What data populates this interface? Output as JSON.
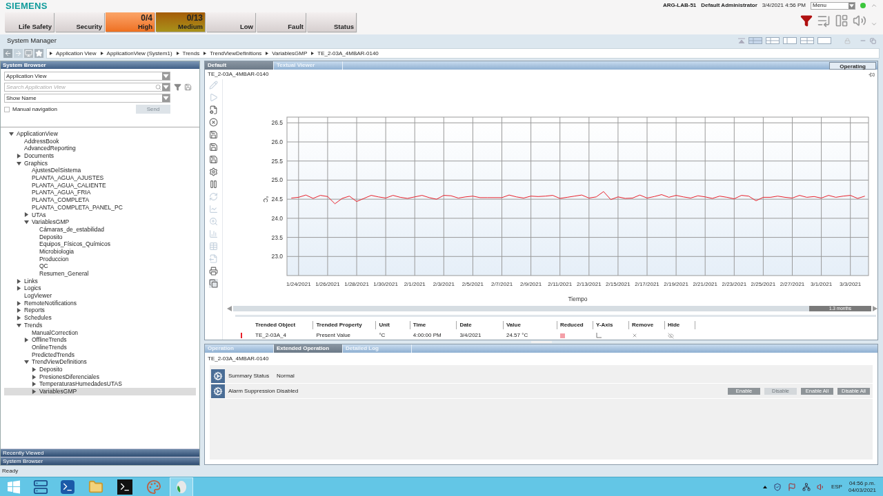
{
  "header": {
    "logo": "SIEMENS",
    "host": "ARG-LAB-51",
    "user": "Default Administrator",
    "date": "3/4/2021",
    "time": "4:56 PM",
    "menu": "Menu",
    "online": true
  },
  "alarm_buttons": [
    {
      "label": "Life Safety",
      "kind": "normal"
    },
    {
      "label": "Security",
      "kind": "normal"
    },
    {
      "label": "High",
      "count": "0/4",
      "kind": "high"
    },
    {
      "label": "Medium",
      "count": "0/13",
      "kind": "medium"
    },
    {
      "label": "Low",
      "kind": "normal"
    },
    {
      "label": "Fault",
      "kind": "normal"
    },
    {
      "label": "Status",
      "kind": "normal"
    }
  ],
  "window": {
    "title": "System Manager"
  },
  "breadcrumb": [
    "Application View",
    "ApplicationView (System1)",
    "Trends",
    "TrendViewDefinitions",
    "VariablesGMP",
    "TE_2-03A_4MBAR-0140"
  ],
  "system_browser": {
    "title": "System Browser",
    "view": "Application View",
    "search": {
      "placeholder": "Search Application View"
    },
    "display": "Show Name",
    "manual_navigation": {
      "label": "Manual navigation",
      "checked": false
    },
    "send": {
      "label": "Send",
      "disabled": true
    },
    "tree": [
      {
        "label": "ApplicationView",
        "expanded": true,
        "selected": false,
        "children": [
          {
            "label": "AddressBook",
            "selected": false
          },
          {
            "label": "AdvancedReporting",
            "selected": false
          },
          {
            "label": "Documents",
            "expanded": false,
            "selected": false
          },
          {
            "label": "Graphics",
            "expanded": true,
            "selected": false,
            "children": [
              {
                "label": "AjustesDelSistema",
                "selected": false
              },
              {
                "label": "PLANTA_AGUA_AJUSTES",
                "selected": false
              },
              {
                "label": "PLANTA_AGUA_CALIENTE",
                "selected": false
              },
              {
                "label": "PLANTA_AGUA_FRIA",
                "selected": false
              },
              {
                "label": "PLANTA_COMPLETA",
                "selected": false
              },
              {
                "label": "PLANTA_COMPLETA_PANEL_PC",
                "selected": false
              },
              {
                "label": "UTAs",
                "expanded": false,
                "selected": false
              },
              {
                "label": "VariablesGMP",
                "expanded": true,
                "selected": false,
                "children": [
                  {
                    "label": "Cámaras_de_estabilidad",
                    "selected": false
                  },
                  {
                    "label": "Deposito",
                    "selected": false
                  },
                  {
                    "label": "Equipos_Físicos_Químicos",
                    "selected": false
                  },
                  {
                    "label": "Microbiologia",
                    "selected": false
                  },
                  {
                    "label": "Produccion",
                    "selected": false
                  },
                  {
                    "label": "QC",
                    "selected": false
                  },
                  {
                    "label": "Resumen_General",
                    "selected": false
                  }
                ]
              }
            ]
          },
          {
            "label": "Links",
            "expanded": false,
            "selected": false
          },
          {
            "label": "Logics",
            "expanded": false,
            "selected": false
          },
          {
            "label": "LogViewer",
            "selected": false
          },
          {
            "label": "RemoteNotifications",
            "expanded": false,
            "selected": false
          },
          {
            "label": "Reports",
            "expanded": false,
            "selected": false
          },
          {
            "label": "Schedules",
            "expanded": false,
            "selected": false
          },
          {
            "label": "Trends",
            "expanded": true,
            "selected": false,
            "children": [
              {
                "label": "ManualCorrection",
                "selected": false
              },
              {
                "label": "OfflineTrends",
                "expanded": false,
                "selected": false
              },
              {
                "label": "OnlineTrends",
                "selected": false
              },
              {
                "label": "PredictedTrends",
                "selected": false
              },
              {
                "label": "TrendViewDefinitions",
                "expanded": true,
                "selected": false,
                "children": [
                  {
                    "label": "Deposito",
                    "expanded": false,
                    "selected": false
                  },
                  {
                    "label": "PresionesDiferenciales",
                    "expanded": false,
                    "selected": false
                  },
                  {
                    "label": "TemperaturasHumedadesUTAS",
                    "expanded": false,
                    "selected": false
                  },
                  {
                    "label": "VariablesGMP",
                    "expanded": false,
                    "selected": true
                  }
                ]
              }
            ]
          }
        ]
      }
    ],
    "bottom_bars": [
      "Recently Viewed",
      "System Browser"
    ]
  },
  "trend_pane": {
    "tabs": [
      {
        "label": "Default",
        "selected": true
      },
      {
        "label": "Textual Viewer",
        "selected": false
      }
    ],
    "mode": "Operating",
    "object": "TE_2-03A_4MBAR-0140",
    "toolbar": [
      {
        "disabled": true
      },
      {
        "disabled": true
      },
      {
        "disabled": false
      },
      {
        "disabled": false
      },
      {
        "disabled": false
      },
      {
        "disabled": false
      },
      {
        "disabled": false
      },
      {
        "disabled": false
      },
      {
        "disabled": false
      },
      {
        "disabled": true
      },
      {
        "disabled": true
      },
      {
        "disabled": true
      },
      {
        "disabled": true
      },
      {
        "disabled": true
      },
      {
        "disabled": true
      },
      {
        "disabled": false
      },
      {
        "disabled": false
      }
    ],
    "chart_data": {
      "type": "line",
      "xlabel": "Tiempo",
      "ylabel": "°C",
      "grid": true,
      "ylim": [
        22.5,
        26.65
      ],
      "yticks": [
        {
          "value": 23,
          "label": "23.0"
        },
        23.5,
        {
          "value": 24,
          "label": "24.0"
        },
        24.5,
        {
          "value": 25,
          "label": "25.0"
        },
        25.5,
        {
          "value": 26,
          "label": "26.0"
        },
        26.5
      ],
      "categories": [
        null,
        "1/24/2021",
        null,
        null,
        null,
        "1/26/2021",
        null,
        null,
        null,
        "1/28/2021",
        null,
        null,
        null,
        "1/30/2021",
        null,
        null,
        null,
        "2/1/2021",
        null,
        null,
        null,
        "2/3/2021",
        null,
        null,
        null,
        "2/5/2021",
        null,
        null,
        null,
        "2/7/2021",
        null,
        null,
        null,
        "2/9/2021",
        null,
        null,
        null,
        "2/11/2021",
        null,
        null,
        null,
        "2/13/2021",
        null,
        null,
        null,
        "2/15/2021",
        null,
        null,
        null,
        "2/17/2021",
        null,
        null,
        null,
        "2/19/2021",
        null,
        null,
        null,
        "2/21/2021",
        null,
        null,
        null,
        "2/23/2021",
        null,
        null,
        null,
        "2/25/2021",
        null,
        null,
        null,
        "2/27/2021",
        null,
        null,
        null,
        "3/1/2021",
        null,
        null,
        null,
        "3/3/2021",
        null,
        null
      ],
      "series": [
        {
          "name": "TE_2-03A_4",
          "color": "#e8202a",
          "values": [
            24.53,
            24.55,
            24.61,
            24.52,
            24.6,
            24.57,
            24.38,
            24.52,
            24.58,
            24.44,
            24.52,
            24.6,
            24.56,
            24.53,
            24.6,
            24.55,
            24.52,
            24.56,
            24.6,
            24.54,
            24.5,
            24.6,
            24.59,
            24.53,
            24.56,
            24.58,
            24.54,
            24.54,
            24.54,
            24.54,
            24.61,
            24.56,
            24.53,
            24.58,
            24.57,
            24.58,
            24.6,
            24.52,
            24.55,
            24.58,
            24.61,
            24.53,
            24.56,
            24.7,
            24.49,
            24.56,
            24.52,
            24.53,
            24.61,
            24.53,
            24.57,
            24.62,
            24.55,
            24.6,
            24.56,
            24.53,
            24.59,
            24.56,
            24.52,
            24.58,
            24.55,
            24.51,
            24.6,
            24.58,
            24.46,
            24.55,
            24.55,
            24.58,
            24.55,
            24.53,
            24.6,
            24.55,
            24.57,
            24.53,
            24.6,
            24.55,
            24.58,
            24.6,
            24.52,
            24.58
          ]
        }
      ]
    },
    "range": "1.3 months",
    "legend": {
      "columns": [
        "Trended Object",
        "Trended Property",
        "Unit",
        "Time",
        "Date",
        "Value",
        "Reduced",
        "Y-Axis",
        "Remove",
        "Hide"
      ],
      "rows": [
        {
          "property": "Present Value",
          "unit": "°C",
          "time": "4:00:00 PM",
          "date": "3/4/2021",
          "value": "24.57 °C",
          "reduced": true
        }
      ]
    }
  },
  "operation_pane": {
    "tabs": [
      {
        "label": "Operation",
        "selected": false
      },
      {
        "label": "Extended Operation",
        "selected": true
      },
      {
        "label": "Detailed Log",
        "selected": false
      }
    ],
    "object": "TE_2-03A_4MBAR-0140",
    "rows": [
      {
        "label": "Summary Status",
        "value": "Normal"
      },
      {
        "label": "Alarm Suppression",
        "value": "Disabled"
      }
    ],
    "buttons": [
      {
        "label": "Enable",
        "disabled": false
      },
      {
        "label": "Disable",
        "disabled": true
      },
      {
        "label": "Enable All",
        "disabled": false
      },
      {
        "label": "Disable All",
        "disabled": false
      }
    ]
  },
  "status_bar": "Ready",
  "taskbar": {
    "language": "ESP",
    "time": "04:56 p.m.",
    "date": "04/03/2021"
  }
}
